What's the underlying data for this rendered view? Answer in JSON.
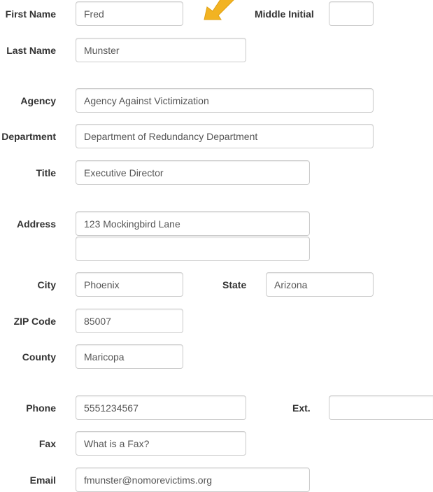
{
  "labels": {
    "first_name": "First Name",
    "middle_initial": "Middle Initial",
    "last_name": "Last Name",
    "agency": "Agency",
    "department": "Department",
    "title": "Title",
    "address": "Address",
    "city": "City",
    "state": "State",
    "zip": "ZIP Code",
    "county": "County",
    "phone": "Phone",
    "ext": "Ext.",
    "fax": "Fax",
    "email": "Email"
  },
  "values": {
    "first_name": "Fred",
    "middle_initial": "",
    "last_name": "Munster",
    "agency": "Agency Against Victimization",
    "department": "Department of Redundancy Department",
    "title": "Executive Director",
    "address_line1": "123 Mockingbird Lane",
    "address_line2": "",
    "city": "Phoenix",
    "state": "Arizona",
    "zip": "85007",
    "county": "Maricopa",
    "phone": "5551234567",
    "ext": "",
    "fax": "What is a Fax?",
    "email": "fmunster@nomorevictims.org"
  },
  "annotation": {
    "icon": "pointer-arrow-icon",
    "color": "#f2b322"
  }
}
